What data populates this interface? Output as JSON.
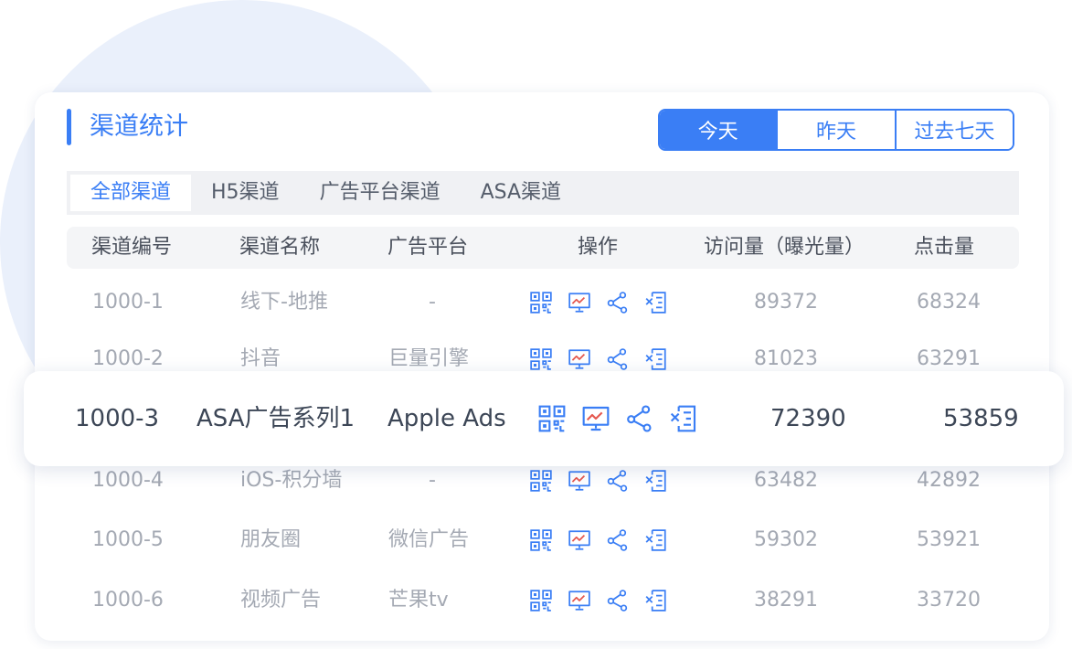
{
  "panel": {
    "title": "渠道统计"
  },
  "range": {
    "options": [
      "今天",
      "昨天",
      "过去七天"
    ],
    "selected_index": 0
  },
  "tabs": [
    "全部渠道",
    "H5渠道",
    "广告平台渠道",
    "ASA渠道"
  ],
  "active_tab_index": 0,
  "columns": [
    "渠道编号",
    "渠道名称",
    "广告平台",
    "操作",
    "访问量（曝光量）",
    "点击量"
  ],
  "rows": [
    {
      "id": "1000-1",
      "name": "线下-地推",
      "platform": "-",
      "visits": "89372",
      "clicks": "68324"
    },
    {
      "id": "1000-2",
      "name": "抖音",
      "platform": "巨量引擎",
      "visits": "81023",
      "clicks": "63291"
    },
    {
      "id": "1000-3",
      "name": "ASA广告系列1",
      "platform": "Apple Ads",
      "visits": "72390",
      "clicks": "53859"
    },
    {
      "id": "1000-4",
      "name": "iOS-积分墙",
      "platform": "-",
      "visits": "63482",
      "clicks": "42892"
    },
    {
      "id": "1000-5",
      "name": "朋友圈",
      "platform": "微信广告",
      "visits": "59302",
      "clicks": "53921"
    },
    {
      "id": "1000-6",
      "name": "视频广告",
      "platform": "芒果tv",
      "visits": "38291",
      "clicks": "33720"
    }
  ],
  "op_icons": [
    "qrcode-icon",
    "chart-icon",
    "share-icon",
    "export-icon"
  ],
  "colors": {
    "accent": "#3a7ef5",
    "muted_text": "#a4a9b3",
    "strong_text": "#3c4656"
  }
}
